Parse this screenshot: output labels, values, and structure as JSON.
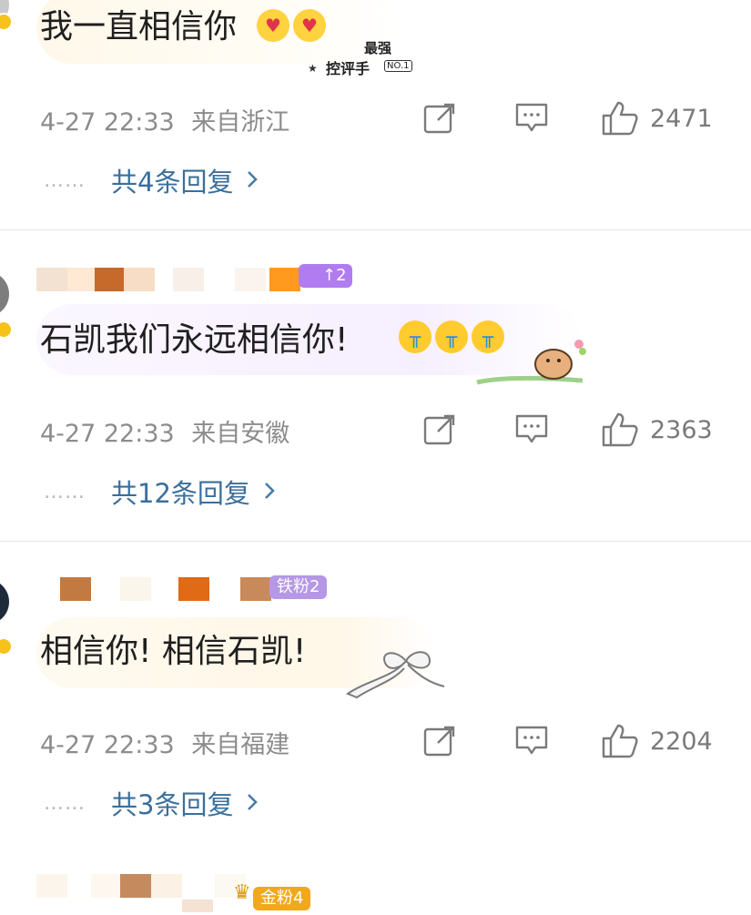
{
  "comments": [
    {
      "text": "我一直相信你",
      "badge": {
        "line1": "最强",
        "line2": "控评手",
        "rank": "NO.1"
      },
      "time": "4-27 22:33",
      "location": "来自浙江",
      "likes": "2471",
      "replies": "共4条回复"
    },
    {
      "level_tag": "↑2",
      "text": "石凯我们永远相信你!",
      "time": "4-27 22:33",
      "location": "来自安徽",
      "likes": "2363",
      "replies": "共12条回复"
    },
    {
      "fan_tag": "铁粉2",
      "text": "相信你! 相信石凯!",
      "time": "4-27 22:33",
      "location": "来自福建",
      "likes": "2204",
      "replies": "共3条回复"
    },
    {
      "fan_tag": "金粉4"
    }
  ],
  "icons": {
    "share": "share-icon",
    "comment": "comment-icon",
    "like": "thumbs-up-icon",
    "chevron": "chevron-right-icon"
  },
  "colors": {
    "reply_link": "#3a6f9d",
    "meta_text": "#8c8c8c",
    "level_tag": "#b07cf0",
    "gold_tag": "#f2a81d"
  }
}
